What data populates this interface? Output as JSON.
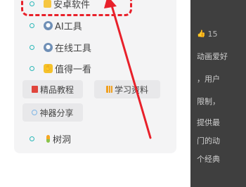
{
  "menu": {
    "items": [
      {
        "label": "安卓软件",
        "icon": "folder-icon"
      },
      {
        "label": "AI工具",
        "icon": "globe-icon"
      },
      {
        "label": "在线工具",
        "icon": "globe-icon"
      },
      {
        "label": "值得一看",
        "icon": "hand-icon"
      },
      {
        "label": "树洞",
        "icon": "seed-icon"
      }
    ],
    "chips": [
      {
        "label": "精品教程",
        "icon": "red-book-icon"
      },
      {
        "label": "学习资料",
        "icon": "books-icon"
      },
      {
        "label": "神器分享",
        "icon": "tool-icon"
      }
    ]
  },
  "right_panel": {
    "like_count": "15",
    "lines": [
      "动画爱好",
      "，用户",
      "限制，",
      "提供最",
      "门的动",
      "个经典"
    ]
  },
  "annotation": {
    "color": "#e8202a"
  }
}
